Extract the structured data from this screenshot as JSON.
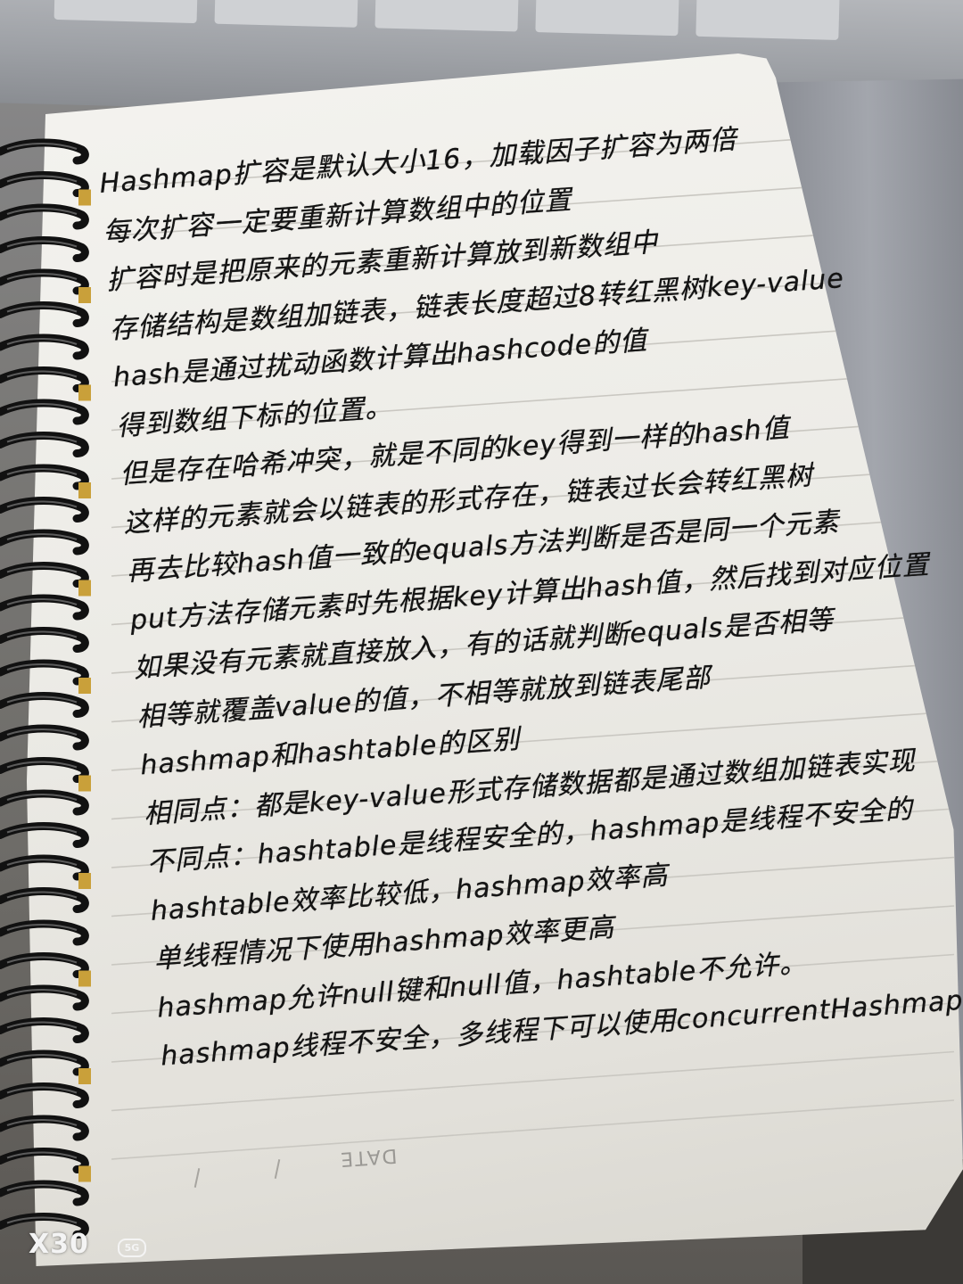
{
  "notes": {
    "lines": [
      "Hashmap扩容是默认大小16，加载因子扩容为两倍",
      "每次扩容一定要重新计算数组中的位置",
      "扩容时是把原来的元素重新计算放到新数组中",
      "存储结构是数组加链表，链表长度超过8转红黑树key-value",
      "hash是通过扰动函数计算出hashcode的值",
      "得到数组下标的位置。",
      "但是存在哈希冲突，就是不同的key得到一样的hash值",
      "这样的元素就会以链表的形式存在，链表过长会转红黑树",
      "再去比较hash值一致的equals方法判断是否是同一个元素",
      "put方法存储元素时先根据key计算出hash值，然后找到对应位置",
      "如果没有元素就直接放入，有的话就判断equals是否相等",
      "相等就覆盖value的值，不相等就放到链表尾部",
      "hashmap和hashtable的区别",
      "相同点：都是key-value形式存储数据都是通过数组加链表实现",
      "不同点：hashtable是线程安全的，hashmap是线程不安全的",
      "hashtable效率比较低，hashmap效率高",
      "单线程情况下使用hashmap效率更高",
      "hashmap允许null键和null值，hashtable不允许。",
      "hashmap线程不安全，多线程下可以使用concurrentHashmap"
    ]
  },
  "page": {
    "date_label": "DATE"
  },
  "camera": {
    "model": "X30",
    "network_badge": "5G"
  }
}
